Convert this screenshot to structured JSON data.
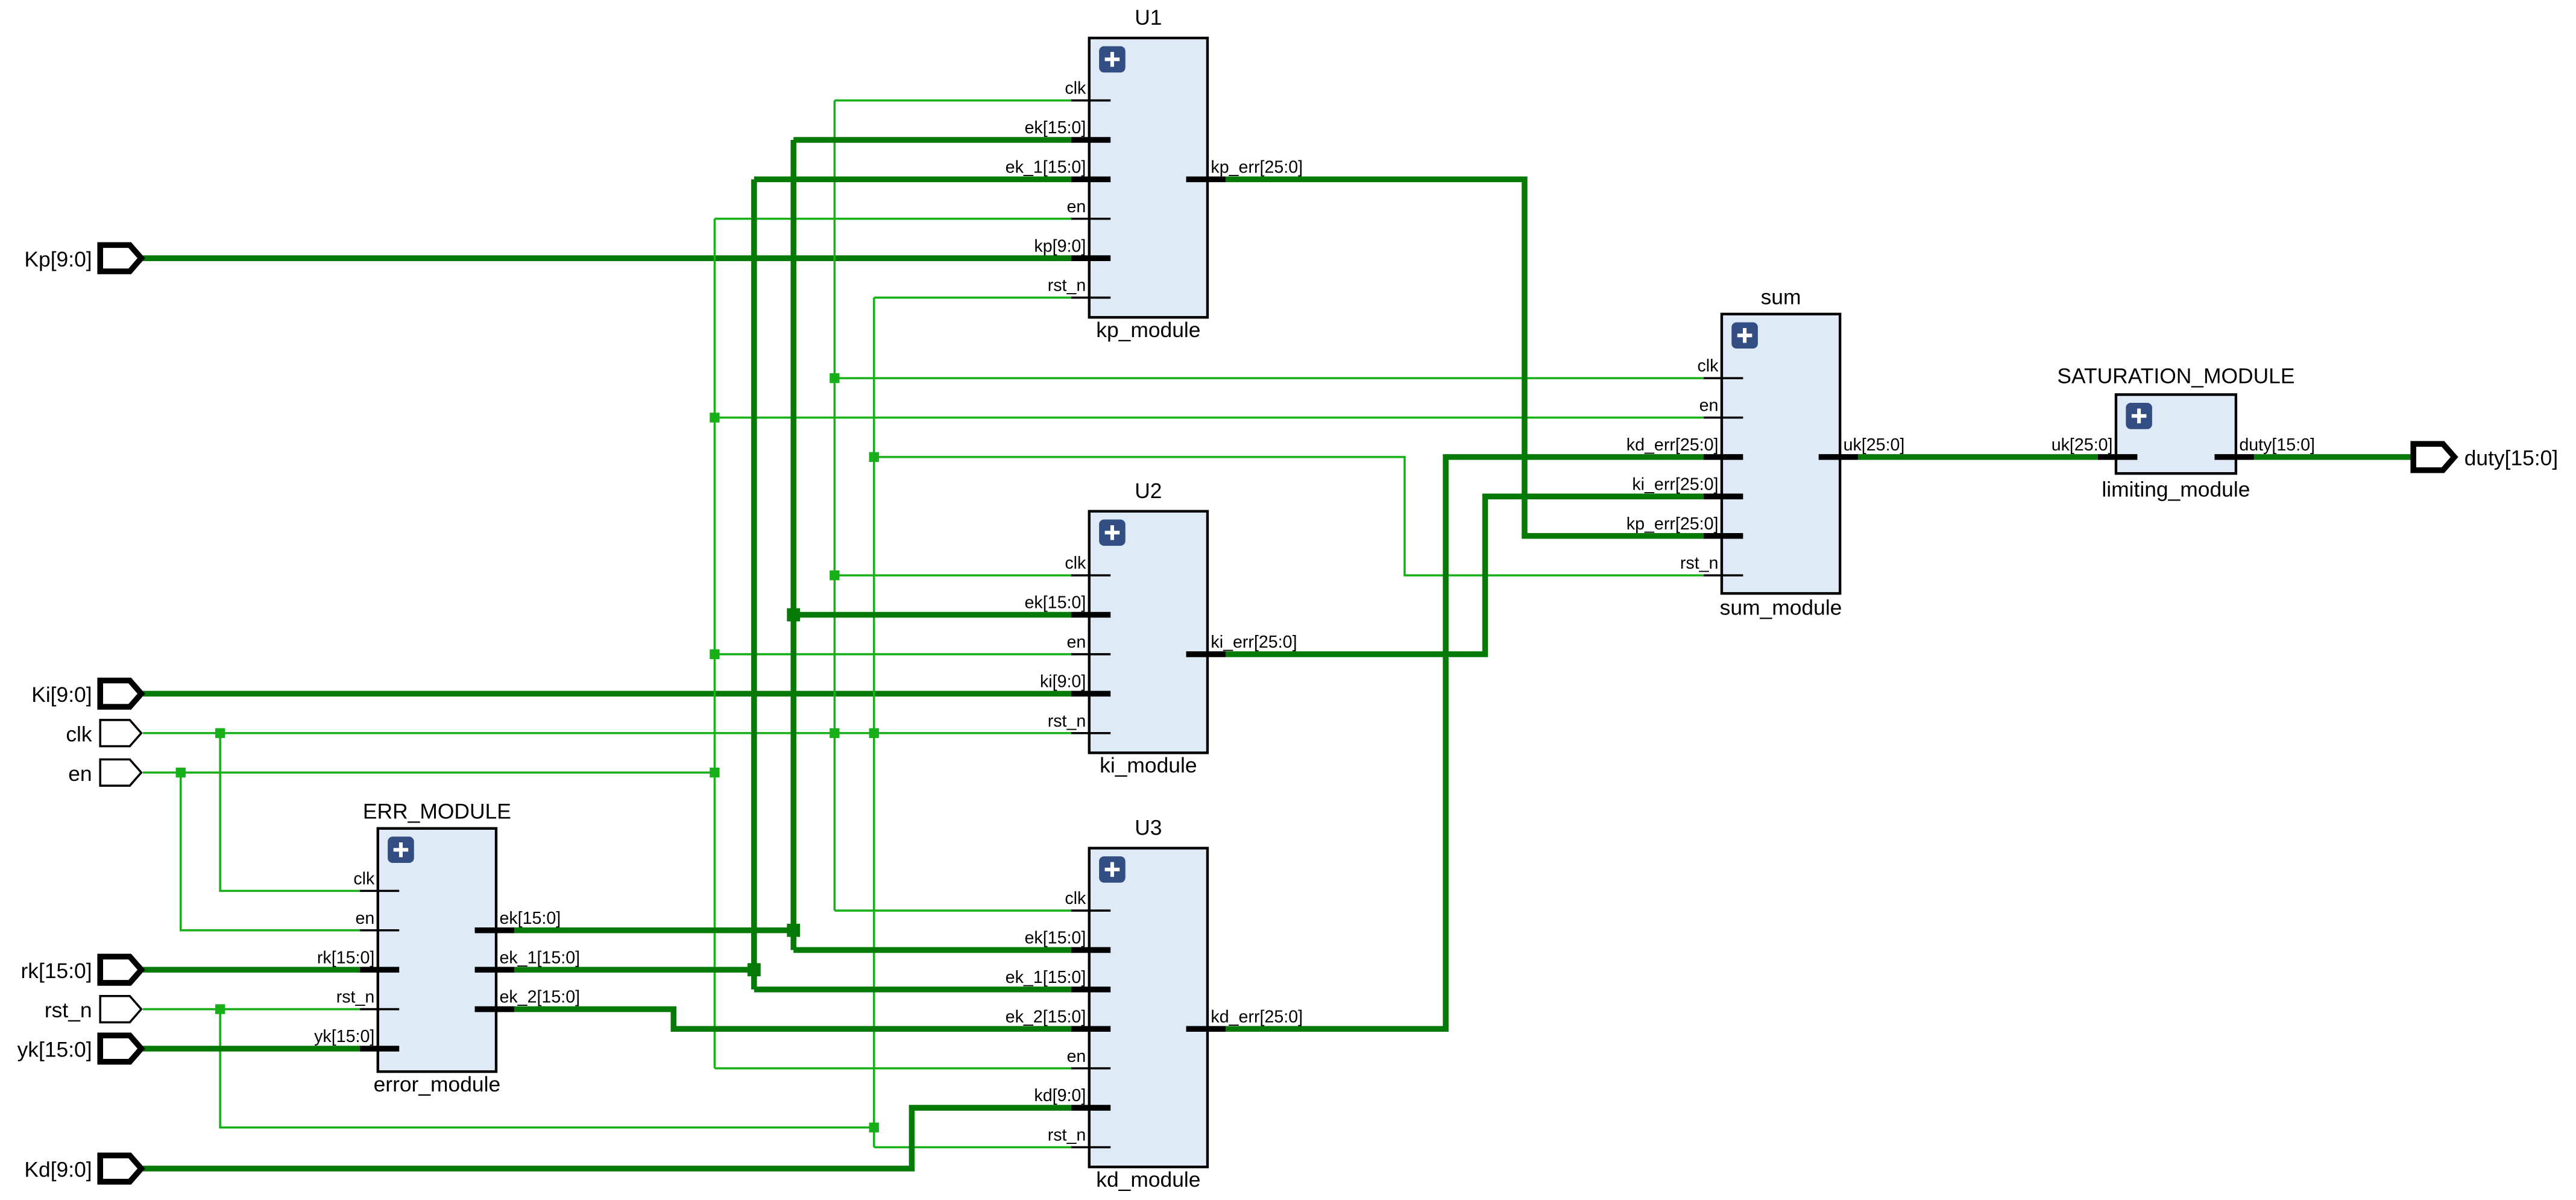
{
  "colors": {
    "net": "#18b018",
    "bus": "#067a06",
    "box_fill": "#dfeaf7",
    "expand_btn": "#334e82"
  },
  "input_ports": [
    {
      "label": "Kp[9:0]",
      "bus": true
    },
    {
      "label": "Ki[9:0]",
      "bus": true
    },
    {
      "label": "clk",
      "bus": false
    },
    {
      "label": "en",
      "bus": false
    },
    {
      "label": "rk[15:0]",
      "bus": true
    },
    {
      "label": "rst_n",
      "bus": false
    },
    {
      "label": "yk[15:0]",
      "bus": true
    },
    {
      "label": "Kd[9:0]",
      "bus": true
    }
  ],
  "output_ports": [
    {
      "label": "duty[15:0]",
      "bus": true
    }
  ],
  "modules": [
    {
      "instance": "U1",
      "module": "kp_module",
      "inputs": [
        "clk",
        "ek[15:0]",
        "ek_1[15:0]",
        "en",
        "kp[9:0]",
        "rst_n"
      ],
      "outputs": [
        "kp_err[25:0]"
      ]
    },
    {
      "instance": "U2",
      "module": "ki_module",
      "inputs": [
        "clk",
        "ek[15:0]",
        "en",
        "ki[9:0]",
        "rst_n"
      ],
      "outputs": [
        "ki_err[25:0]"
      ]
    },
    {
      "instance": "U3",
      "module": "kd_module",
      "inputs": [
        "clk",
        "ek[15:0]",
        "ek_1[15:0]",
        "ek_2[15:0]",
        "en",
        "kd[9:0]",
        "rst_n"
      ],
      "outputs": [
        "kd_err[25:0]"
      ]
    },
    {
      "instance": "sum",
      "module": "sum_module",
      "inputs": [
        "clk",
        "en",
        "kd_err[25:0]",
        "ki_err[25:0]",
        "kp_err[25:0]",
        "rst_n"
      ],
      "outputs": [
        "uk[25:0]"
      ]
    },
    {
      "instance": "SATURATION_MODULE",
      "module": "limiting_module",
      "inputs": [
        "uk[25:0]"
      ],
      "outputs": [
        "duty[15:0]"
      ]
    },
    {
      "instance": "ERR_MODULE",
      "module": "error_module",
      "inputs": [
        "clk",
        "en",
        "rk[15:0]",
        "rst_n",
        "yk[15:0]"
      ],
      "outputs": [
        "ek[15:0]",
        "ek_1[15:0]",
        "ek_2[15:0]"
      ]
    }
  ]
}
